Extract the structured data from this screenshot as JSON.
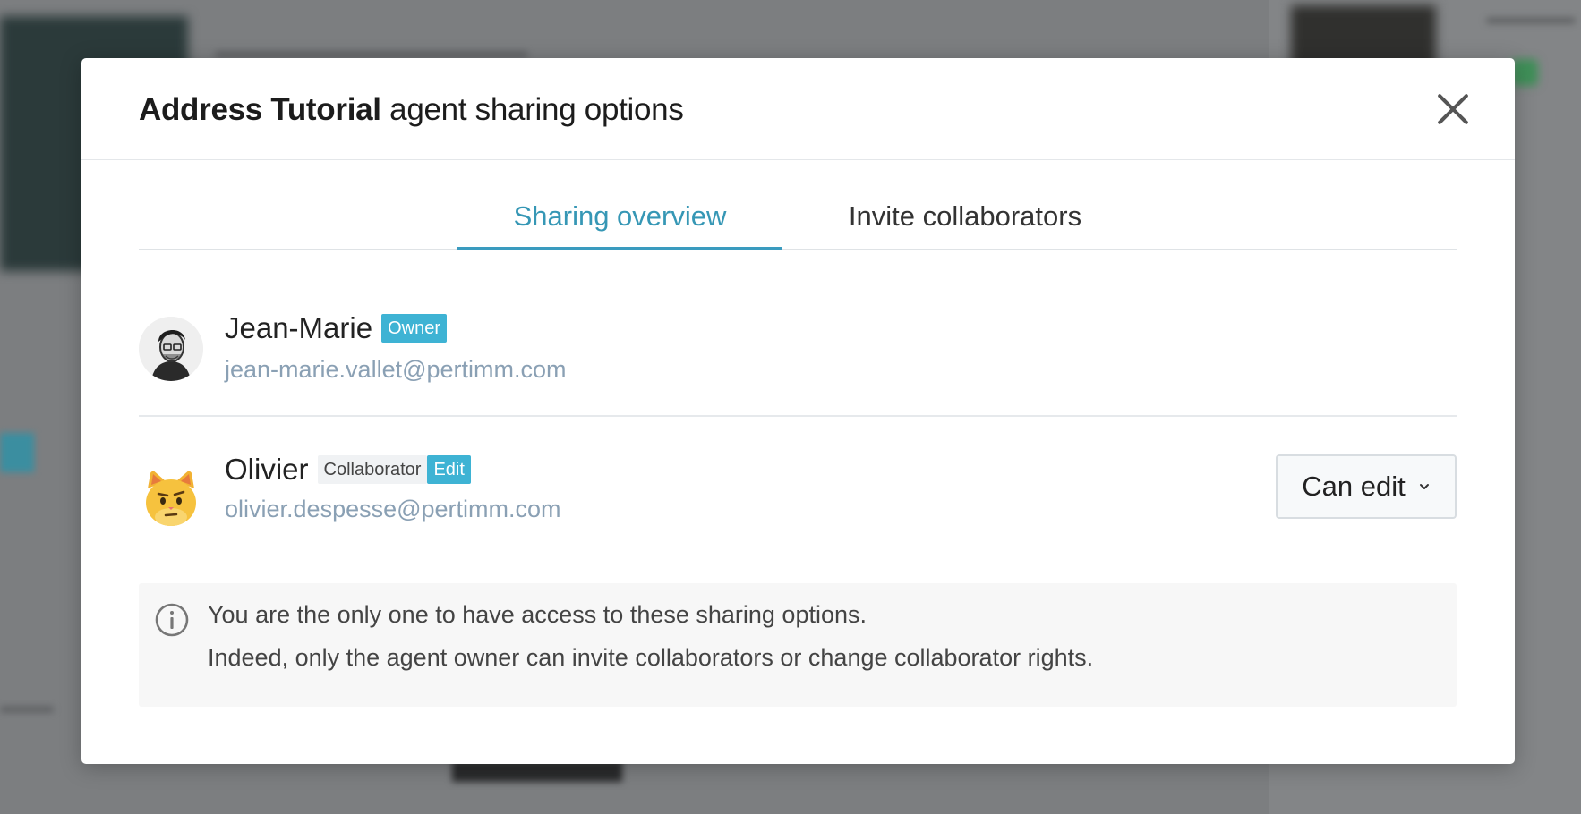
{
  "modal": {
    "title_agent_name": "Address Tutorial",
    "title_suffix": "agent sharing options"
  },
  "tabs": [
    {
      "label": "Sharing overview",
      "active": true
    },
    {
      "label": "Invite collaborators",
      "active": false
    }
  ],
  "members": [
    {
      "name": "Jean-Marie",
      "role_badge": "Owner",
      "email": "jean-marie.vallet@pertimm.com",
      "avatar": "portrait-avatar"
    },
    {
      "name": "Olivier",
      "role_badge": "Collaborator",
      "permission_badge": "Edit",
      "email": "olivier.despesse@pertimm.com",
      "avatar": "cat-emoji-avatar",
      "permission_select": "Can edit"
    }
  ],
  "info": {
    "line1": "You are the only one to have access to these sharing options.",
    "line2": "Indeed, only the agent owner can invite collaborators or change collaborator rights.",
    "icon": "info-icon"
  },
  "colors": {
    "accent": "#3a9bbf",
    "badge": "#3eb3d4",
    "email": "#8aa0b4"
  }
}
